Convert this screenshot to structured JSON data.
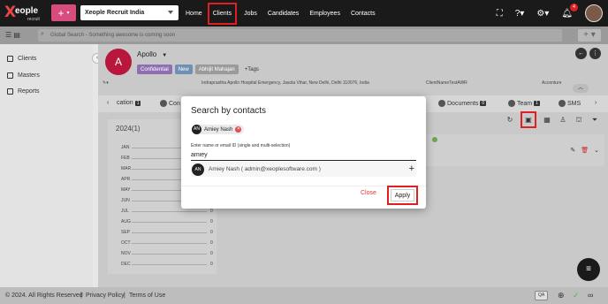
{
  "topbar": {
    "logo_brand": "eople",
    "logo_sub": "recruit",
    "company": "Xeople Recruit India",
    "nav": [
      "Home",
      "Clients",
      "Jobs",
      "Candidates",
      "Employees",
      "Contacts"
    ],
    "notification_count": "4"
  },
  "search": {
    "placeholder": "Global Search - Something awesome is coming soon"
  },
  "sidebar": {
    "items": [
      {
        "label": "Clients"
      },
      {
        "label": "Masters"
      },
      {
        "label": "Reports"
      }
    ]
  },
  "client": {
    "initial": "A",
    "name": "Apollo",
    "chips": [
      "Confidential",
      "New",
      "Abhijit Mahajan",
      "Tags"
    ],
    "address": "Indraprastha Apollo Hospital Emergency, Jasola Vihar, New Delhi, Delhi 110076, India",
    "client_name_tag": "ClientNameTestAWR",
    "company_tag": "Accenture"
  },
  "tabs": [
    {
      "label": "cation",
      "count": "1"
    },
    {
      "label": "Con",
      "count": ""
    },
    {
      "label": "Documents",
      "count": "0"
    },
    {
      "label": "Team",
      "count": "1"
    },
    {
      "label": "SMS",
      "count": ""
    }
  ],
  "year": {
    "title": "2024(1)",
    "months": [
      "JAN",
      "FEB",
      "MAR",
      "APR",
      "MAY",
      "JUN",
      "JUL",
      "AUG",
      "SEP",
      "OCT",
      "NOV",
      "DEC"
    ],
    "values": [
      "0",
      "0",
      "0",
      "0",
      "0",
      "0",
      "0",
      "0",
      "0",
      "0",
      "0",
      "0"
    ]
  },
  "modal": {
    "title": "Search by contacts",
    "selected_chip": {
      "initials": "AN",
      "name": "Amiey Nash"
    },
    "input_label": "Enter name or email ID (single and multi-selection)",
    "input_value": "amiey",
    "suggestion": {
      "initials": "AN",
      "text": "Amiey Nash ( admin@xeoplesoftware.com )"
    },
    "close_label": "Close",
    "apply_label": "Apply"
  },
  "footer": {
    "copyright": "© 2024. All Rights Reserved",
    "privacy": "Privacy Policy",
    "terms": "Terms of Use",
    "env_badge": "QA"
  }
}
